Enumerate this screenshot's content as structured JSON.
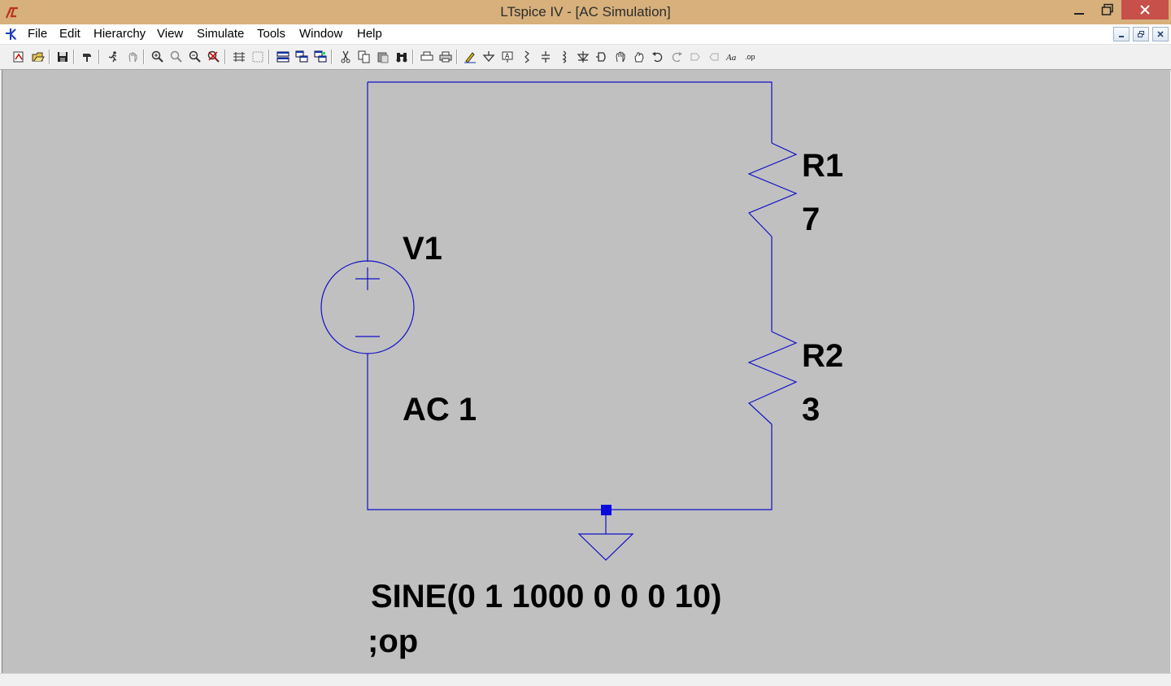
{
  "window": {
    "title": "LTspice IV - [AC Simulation]"
  },
  "menu": {
    "items": [
      {
        "id": "file",
        "label": "File"
      },
      {
        "id": "edit",
        "label": "Edit"
      },
      {
        "id": "hierarchy",
        "label": "Hierarchy"
      },
      {
        "id": "view",
        "label": "View"
      },
      {
        "id": "simulate",
        "label": "Simulate"
      },
      {
        "id": "tools",
        "label": "Tools"
      },
      {
        "id": "window",
        "label": "Window"
      },
      {
        "id": "help",
        "label": "Help"
      }
    ]
  },
  "toolbar": {
    "icons": [
      "new-schematic-icon",
      "open-icon",
      "save-icon",
      "control-panel-icon",
      "run-icon",
      "halt-icon",
      "zoom-in-icon",
      "zoom-full-icon",
      "zoom-out-icon",
      "zoom-cancel-icon",
      "autorange-icon",
      "grid-icon",
      "tile-horizontal-icon",
      "cascade-icon",
      "tile-vertical-icon",
      "cut-icon",
      "copy-icon",
      "paste-icon",
      "find-icon",
      "print-setup-icon",
      "print-icon",
      "draw-wire-icon",
      "ground-icon",
      "label-net-icon",
      "resistor-icon",
      "capacitor-icon",
      "inductor-icon",
      "diode-icon",
      "component-icon",
      "move-icon",
      "drag-icon",
      "undo-icon",
      "redo-icon",
      "rotate-icon",
      "mirror-icon",
      "text-icon",
      "spice-directive-icon"
    ]
  },
  "schematic": {
    "source": {
      "name": "V1",
      "value": "AC 1"
    },
    "resistors": [
      {
        "name": "R1",
        "value": "7"
      },
      {
        "name": "R2",
        "value": "3"
      }
    ],
    "directives": {
      "sine": "SINE(0 1 1000 0 0 0 10)",
      "op": ";op"
    },
    "wire_color": "#1010c8"
  }
}
